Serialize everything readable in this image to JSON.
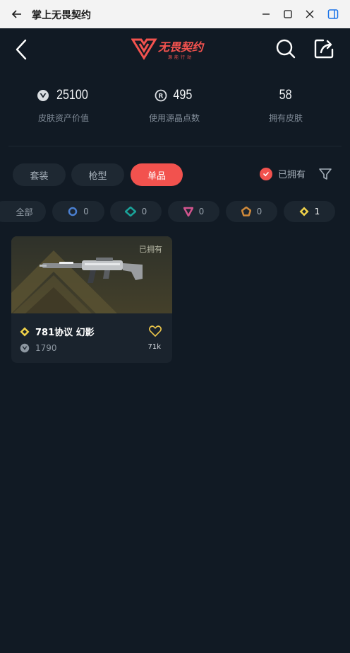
{
  "window": {
    "title": "掌上无畏契约"
  },
  "header": {
    "logo_text": "无畏契约",
    "logo_sub": "源能行动"
  },
  "stats": [
    {
      "value": "25100",
      "label": "皮肤资产价值",
      "icon": "vp-icon"
    },
    {
      "value": "495",
      "label": "使用源晶点数",
      "icon": "radianite-icon"
    },
    {
      "value": "58",
      "label": "拥有皮肤",
      "icon": ""
    }
  ],
  "tabs": [
    {
      "label": "套装",
      "active": false
    },
    {
      "label": "枪型",
      "active": false
    },
    {
      "label": "单品",
      "active": true
    }
  ],
  "owned_filter": {
    "label": "已拥有",
    "checked": true
  },
  "rarity_chips": [
    {
      "label": "全部",
      "count": ""
    },
    {
      "label": "",
      "count": "0",
      "tier": "select",
      "color": "#4a7fd0"
    },
    {
      "label": "",
      "count": "0",
      "tier": "deluxe",
      "color": "#1aa39a"
    },
    {
      "label": "",
      "count": "0",
      "tier": "premium",
      "color": "#d1548d"
    },
    {
      "label": "",
      "count": "0",
      "tier": "exclusive",
      "color": "#d08a3a"
    },
    {
      "label": "",
      "count": "1",
      "tier": "ultra",
      "color": "#f0d24a"
    }
  ],
  "items": [
    {
      "owned_badge": "已拥有",
      "name": "781协议 幻影",
      "price": "1790",
      "likes": "71k",
      "tier_color": "#f0d24a"
    }
  ],
  "colors": {
    "accent": "#f2524e",
    "background": "#111a24"
  }
}
